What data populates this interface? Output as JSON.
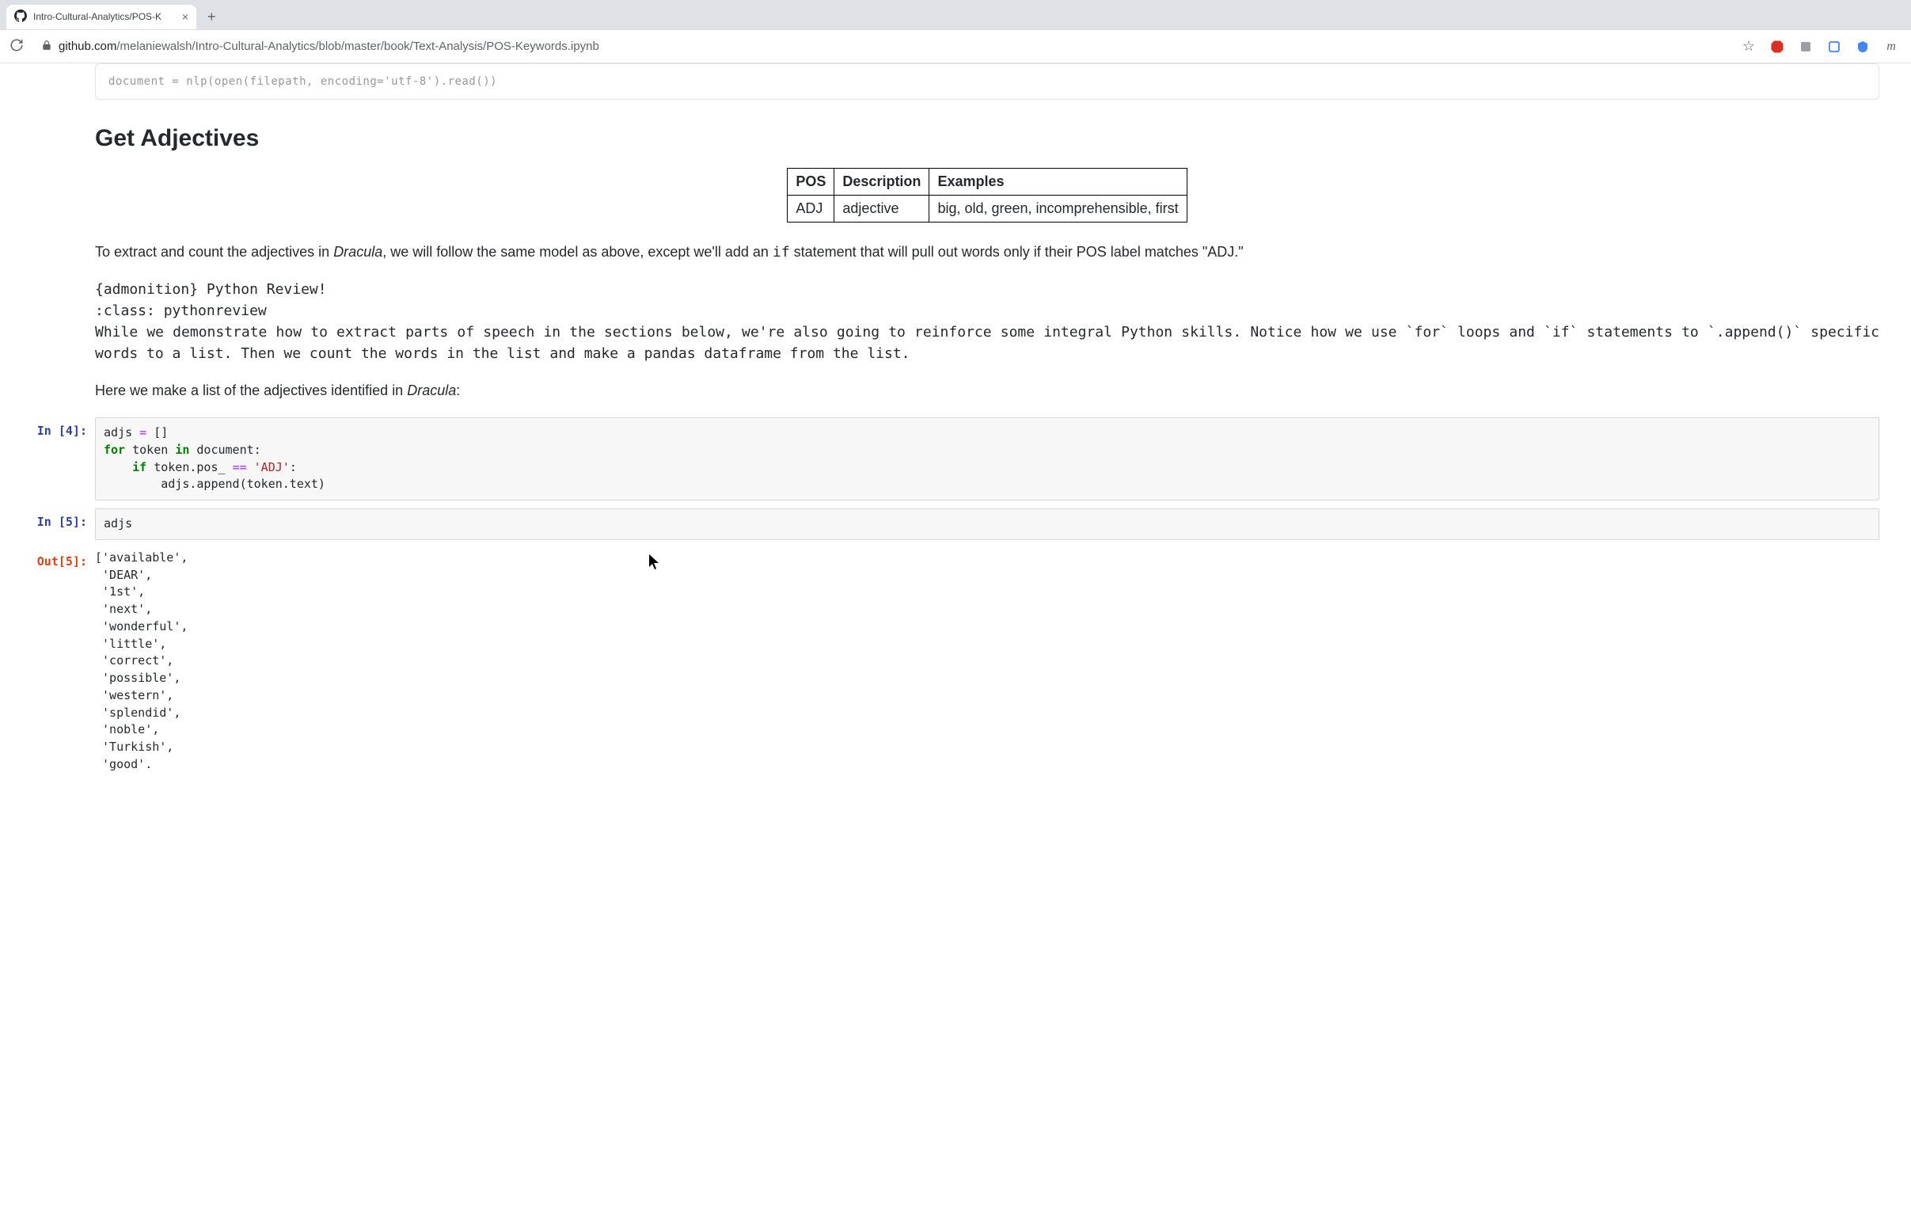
{
  "browser": {
    "tab_title": "Intro-Cultural-Analytics/POS-K",
    "url_host": "github.com",
    "url_path": "/melaniewalsh/Intro-Cultural-Analytics/blob/master/book/Text-Analysis/POS-Keywords.ipynb",
    "new_tab_glyph": "+",
    "tab_close_glyph": "×",
    "star_glyph": "☆",
    "m_glyph": "m"
  },
  "truncated_line": "document = nlp(open(filepath, encoding='utf-8').read())",
  "heading": "Get Adjectives",
  "table": {
    "h_pos": "POS",
    "h_desc": "Description",
    "h_ex": "Examples",
    "pos": "ADJ",
    "desc": "adjective",
    "ex": "big, old, green, incomprehensible, first"
  },
  "para1_pre": "To extract and count the adjectives in ",
  "para1_em1": "Dracula",
  "para1_mid": ", we will follow the same model as above, except we'll add an ",
  "para1_code": "if",
  "para1_post": " statement that will pull out words only if their POS label matches \"ADJ.\"",
  "admonition_l1": "{admonition} Python Review!",
  "admonition_l2": ":class: pythonreview",
  "admonition_body": "While we demonstrate how to extract parts of speech in the sections below, we're also going to reinforce some integral Python skills. Notice how we use `for` loops and `if` statements to `.append()` specific words to a list. Then we count the words in the list and make a pandas dataframe from the list.",
  "para2_pre": "Here we make a list of the adjectives identified in ",
  "para2_em": "Dracula",
  "para2_post": ":",
  "cells": {
    "in4_prompt": "In [4]:",
    "in4": {
      "l1_a": "adjs ",
      "l1_op": "=",
      "l1_b": " []",
      "l2_for": "for",
      "l2_a": " token ",
      "l2_in": "in",
      "l2_b": " document:",
      "l3_pad": "    ",
      "l3_if": "if",
      "l3_a": " token.pos_ ",
      "l3_eq": "==",
      "l3_sp": " ",
      "l3_str": "'ADJ'",
      "l3_b": ":",
      "l4_pad": "        ",
      "l4_a": "adjs.append(token.text)"
    },
    "in5_prompt": "In [5]:",
    "in5_body": "adjs",
    "out5_prompt": "Out[5]:",
    "out5_body": "['available',\n 'DEAR',\n '1st',\n 'next',\n 'wonderful',\n 'little',\n 'correct',\n 'possible',\n 'western',\n 'splendid',\n 'noble',\n 'Turkish',\n 'good'."
  }
}
